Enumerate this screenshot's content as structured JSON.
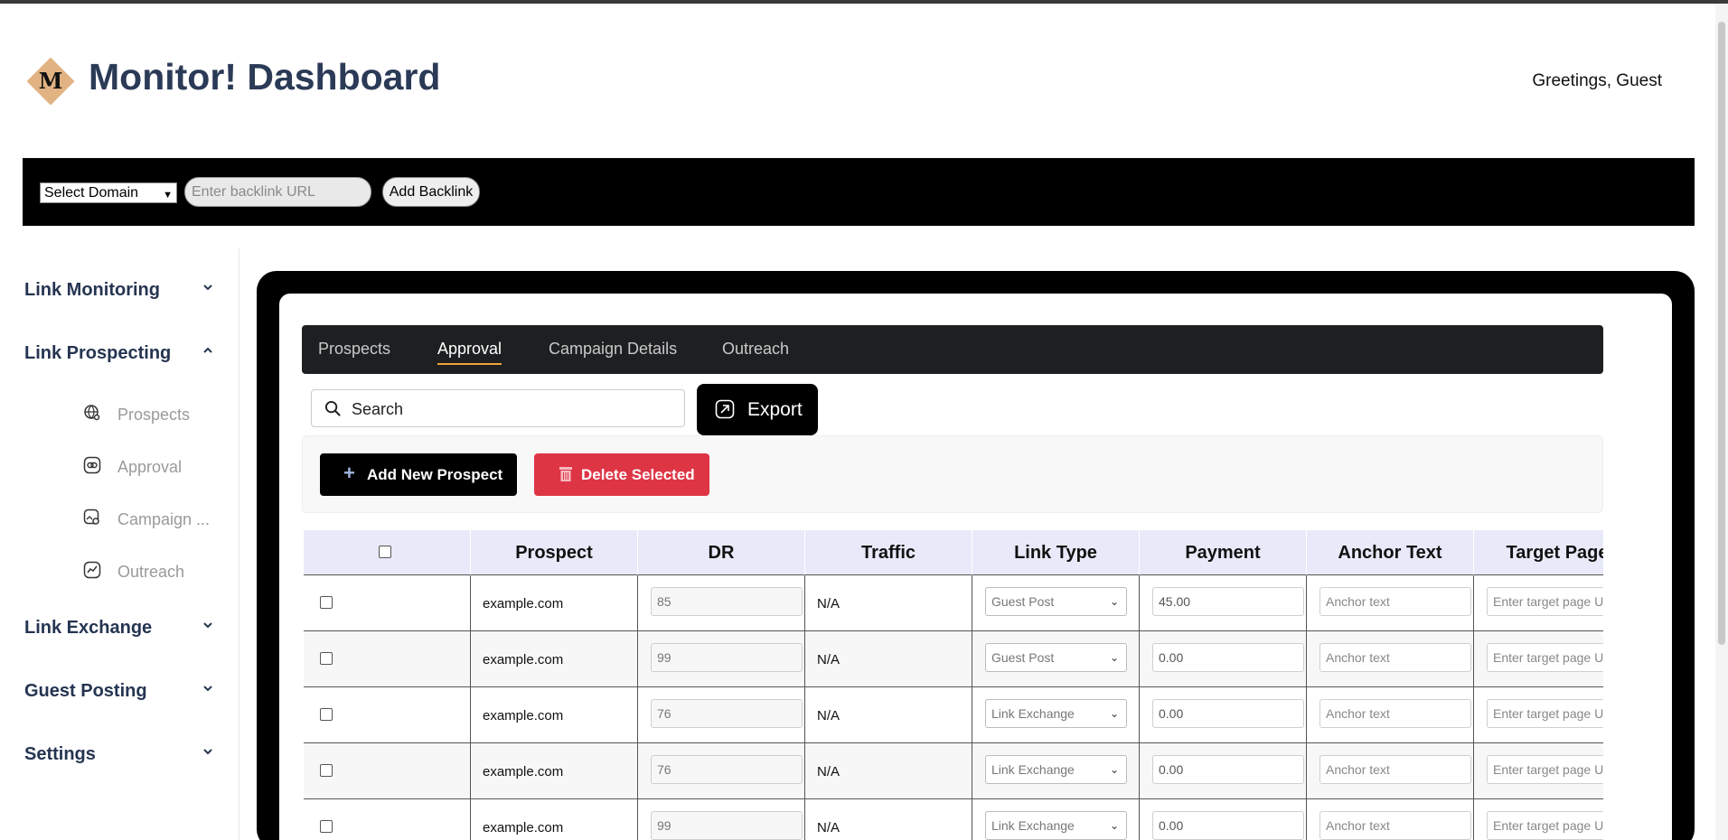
{
  "header": {
    "logo_letter": "M",
    "title": "Monitor! Dashboard",
    "greeting": "Greetings, Guest"
  },
  "toolbar": {
    "domain_select": "Select Domain",
    "backlink_placeholder": "Enter backlink URL",
    "add_backlink": "Add Backlink"
  },
  "sidebar": {
    "groups": [
      {
        "label": "Link Monitoring",
        "expanded": false
      },
      {
        "label": "Link Prospecting",
        "expanded": true
      },
      {
        "label": "Link Exchange",
        "expanded": false
      },
      {
        "label": "Guest Posting",
        "expanded": false
      },
      {
        "label": "Settings",
        "expanded": false
      }
    ],
    "subitems": [
      {
        "label": "Prospects",
        "icon": "globe-search-icon"
      },
      {
        "label": "Approval",
        "icon": "link-icon"
      },
      {
        "label": "Campaign ...",
        "icon": "image-search-icon"
      },
      {
        "label": "Outreach",
        "icon": "chart-line-icon"
      }
    ]
  },
  "tabs": [
    {
      "label": "Prospects",
      "active": false
    },
    {
      "label": "Approval",
      "active": true
    },
    {
      "label": "Campaign Details",
      "active": false
    },
    {
      "label": "Outreach",
      "active": false
    }
  ],
  "search": {
    "placeholder": "Search"
  },
  "export_label": "Export",
  "actions": {
    "add_label": "Add New Prospect",
    "delete_label": "Delete Selected"
  },
  "table": {
    "columns": [
      "Prospect",
      "DR",
      "Traffic",
      "Link Type",
      "Payment",
      "Anchor Text",
      "Target Page"
    ],
    "anchor_placeholder": "Anchor text",
    "target_placeholder": "Enter target page U",
    "rows": [
      {
        "prospect": "example.com",
        "dr": "85",
        "traffic": "N/A",
        "link_type": "Guest Post",
        "payment": "45.00"
      },
      {
        "prospect": "example.com",
        "dr": "99",
        "traffic": "N/A",
        "link_type": "Guest Post",
        "payment": "0.00"
      },
      {
        "prospect": "example.com",
        "dr": "76",
        "traffic": "N/A",
        "link_type": "Link Exchange",
        "payment": "0.00"
      },
      {
        "prospect": "example.com",
        "dr": "76",
        "traffic": "N/A",
        "link_type": "Link Exchange",
        "payment": "0.00"
      },
      {
        "prospect": "example.com",
        "dr": "99",
        "traffic": "N/A",
        "link_type": "Link Exchange",
        "payment": "0.00"
      }
    ]
  },
  "colors": {
    "title": "#2b3a56",
    "logo": "#e1b383",
    "delete": "#de3545",
    "tab_underline": "#f0a33a",
    "table_header": "#e8eaf9"
  }
}
